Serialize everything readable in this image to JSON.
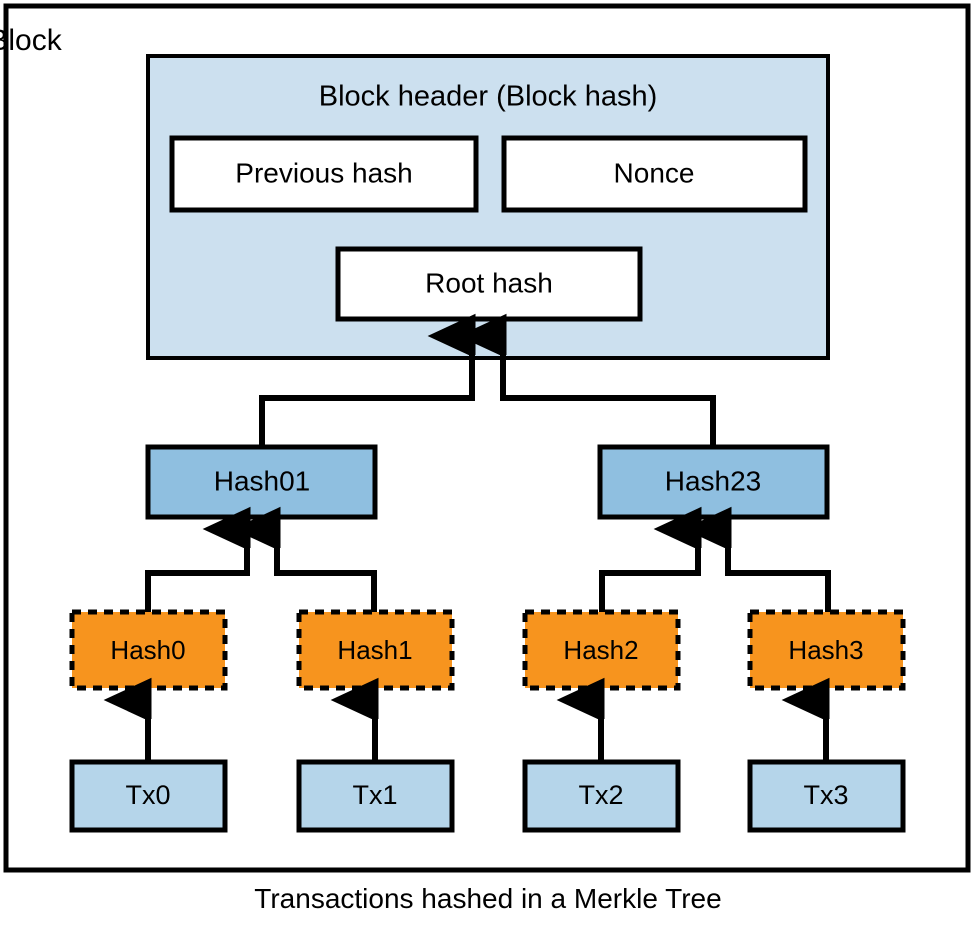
{
  "diagram": {
    "title": "Transactions hashed in a Merkle Tree",
    "outer_label": "Block",
    "header": {
      "title": "Block header (Block hash)",
      "fields": [
        {
          "label": "Previous hash"
        },
        {
          "label": "Nonce"
        },
        {
          "label": "Root hash"
        }
      ]
    },
    "intermediate_hashes": [
      {
        "label": "Hash01"
      },
      {
        "label": "Hash23"
      }
    ],
    "leaf_hashes": [
      {
        "label": "Hash0"
      },
      {
        "label": "Hash1"
      },
      {
        "label": "Hash2"
      },
      {
        "label": "Hash3"
      }
    ],
    "transactions": [
      {
        "label": "Tx0"
      },
      {
        "label": "Tx1"
      },
      {
        "label": "Tx2"
      },
      {
        "label": "Tx3"
      }
    ],
    "colors": {
      "header_fill": "#cce0ef",
      "intermediate_fill": "#8fbfe0",
      "leaf_fill": "#f7941e",
      "transaction_fill": "#b5d5ea",
      "field_fill": "#ffffff",
      "stroke": "#000000",
      "page_background": "#ffffff"
    }
  }
}
